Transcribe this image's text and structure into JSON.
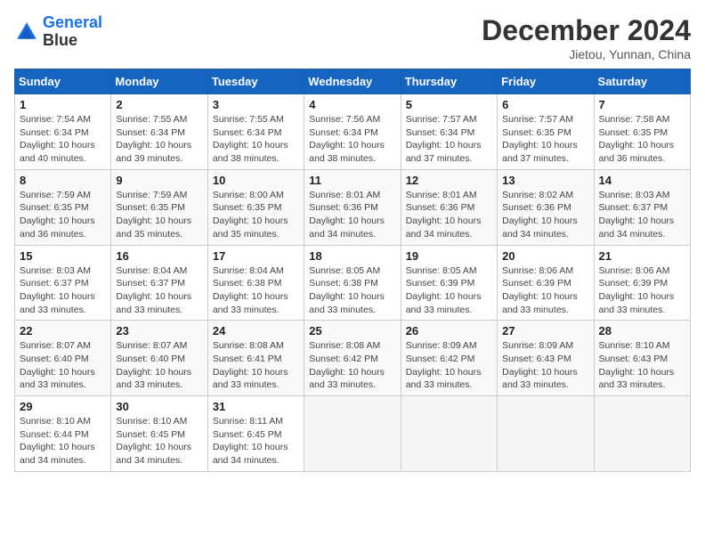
{
  "header": {
    "logo_line1": "General",
    "logo_line2": "Blue",
    "month": "December 2024",
    "location": "Jietou, Yunnan, China"
  },
  "days_of_week": [
    "Sunday",
    "Monday",
    "Tuesday",
    "Wednesday",
    "Thursday",
    "Friday",
    "Saturday"
  ],
  "weeks": [
    [
      {
        "day": "1",
        "sunrise": "7:54 AM",
        "sunset": "6:34 PM",
        "daylight": "10 hours and 40 minutes."
      },
      {
        "day": "2",
        "sunrise": "7:55 AM",
        "sunset": "6:34 PM",
        "daylight": "10 hours and 39 minutes."
      },
      {
        "day": "3",
        "sunrise": "7:55 AM",
        "sunset": "6:34 PM",
        "daylight": "10 hours and 38 minutes."
      },
      {
        "day": "4",
        "sunrise": "7:56 AM",
        "sunset": "6:34 PM",
        "daylight": "10 hours and 38 minutes."
      },
      {
        "day": "5",
        "sunrise": "7:57 AM",
        "sunset": "6:34 PM",
        "daylight": "10 hours and 37 minutes."
      },
      {
        "day": "6",
        "sunrise": "7:57 AM",
        "sunset": "6:35 PM",
        "daylight": "10 hours and 37 minutes."
      },
      {
        "day": "7",
        "sunrise": "7:58 AM",
        "sunset": "6:35 PM",
        "daylight": "10 hours and 36 minutes."
      }
    ],
    [
      {
        "day": "8",
        "sunrise": "7:59 AM",
        "sunset": "6:35 PM",
        "daylight": "10 hours and 36 minutes."
      },
      {
        "day": "9",
        "sunrise": "7:59 AM",
        "sunset": "6:35 PM",
        "daylight": "10 hours and 35 minutes."
      },
      {
        "day": "10",
        "sunrise": "8:00 AM",
        "sunset": "6:35 PM",
        "daylight": "10 hours and 35 minutes."
      },
      {
        "day": "11",
        "sunrise": "8:01 AM",
        "sunset": "6:36 PM",
        "daylight": "10 hours and 34 minutes."
      },
      {
        "day": "12",
        "sunrise": "8:01 AM",
        "sunset": "6:36 PM",
        "daylight": "10 hours and 34 minutes."
      },
      {
        "day": "13",
        "sunrise": "8:02 AM",
        "sunset": "6:36 PM",
        "daylight": "10 hours and 34 minutes."
      },
      {
        "day": "14",
        "sunrise": "8:03 AM",
        "sunset": "6:37 PM",
        "daylight": "10 hours and 34 minutes."
      }
    ],
    [
      {
        "day": "15",
        "sunrise": "8:03 AM",
        "sunset": "6:37 PM",
        "daylight": "10 hours and 33 minutes."
      },
      {
        "day": "16",
        "sunrise": "8:04 AM",
        "sunset": "6:37 PM",
        "daylight": "10 hours and 33 minutes."
      },
      {
        "day": "17",
        "sunrise": "8:04 AM",
        "sunset": "6:38 PM",
        "daylight": "10 hours and 33 minutes."
      },
      {
        "day": "18",
        "sunrise": "8:05 AM",
        "sunset": "6:38 PM",
        "daylight": "10 hours and 33 minutes."
      },
      {
        "day": "19",
        "sunrise": "8:05 AM",
        "sunset": "6:39 PM",
        "daylight": "10 hours and 33 minutes."
      },
      {
        "day": "20",
        "sunrise": "8:06 AM",
        "sunset": "6:39 PM",
        "daylight": "10 hours and 33 minutes."
      },
      {
        "day": "21",
        "sunrise": "8:06 AM",
        "sunset": "6:39 PM",
        "daylight": "10 hours and 33 minutes."
      }
    ],
    [
      {
        "day": "22",
        "sunrise": "8:07 AM",
        "sunset": "6:40 PM",
        "daylight": "10 hours and 33 minutes."
      },
      {
        "day": "23",
        "sunrise": "8:07 AM",
        "sunset": "6:40 PM",
        "daylight": "10 hours and 33 minutes."
      },
      {
        "day": "24",
        "sunrise": "8:08 AM",
        "sunset": "6:41 PM",
        "daylight": "10 hours and 33 minutes."
      },
      {
        "day": "25",
        "sunrise": "8:08 AM",
        "sunset": "6:42 PM",
        "daylight": "10 hours and 33 minutes."
      },
      {
        "day": "26",
        "sunrise": "8:09 AM",
        "sunset": "6:42 PM",
        "daylight": "10 hours and 33 minutes."
      },
      {
        "day": "27",
        "sunrise": "8:09 AM",
        "sunset": "6:43 PM",
        "daylight": "10 hours and 33 minutes."
      },
      {
        "day": "28",
        "sunrise": "8:10 AM",
        "sunset": "6:43 PM",
        "daylight": "10 hours and 33 minutes."
      }
    ],
    [
      {
        "day": "29",
        "sunrise": "8:10 AM",
        "sunset": "6:44 PM",
        "daylight": "10 hours and 34 minutes."
      },
      {
        "day": "30",
        "sunrise": "8:10 AM",
        "sunset": "6:45 PM",
        "daylight": "10 hours and 34 minutes."
      },
      {
        "day": "31",
        "sunrise": "8:11 AM",
        "sunset": "6:45 PM",
        "daylight": "10 hours and 34 minutes."
      },
      null,
      null,
      null,
      null
    ]
  ]
}
